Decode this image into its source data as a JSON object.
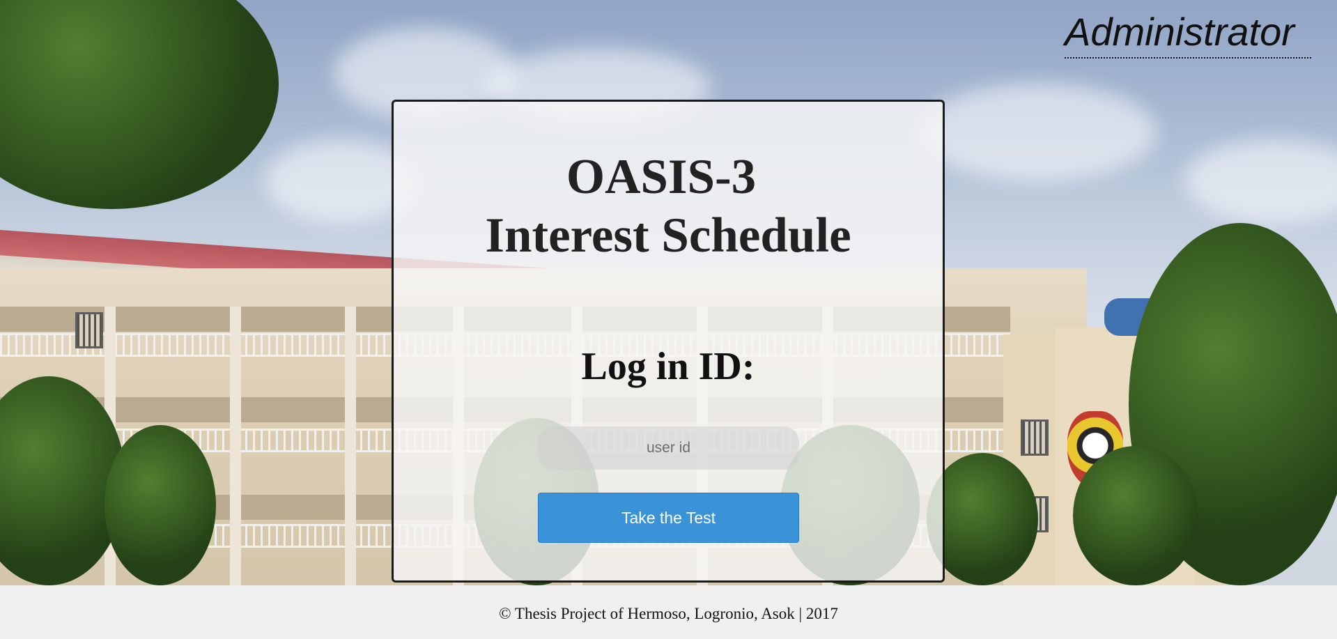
{
  "header": {
    "admin_link": "Administrator"
  },
  "login": {
    "title_line1": "OASIS-3",
    "title_line2": "Interest Schedule",
    "label": "Log in ID:",
    "userid_placeholder": "user id",
    "userid_value": "",
    "submit_label": "Take the Test"
  },
  "footer": {
    "text": "© Thesis Project of Hermoso, Logronio, Asok | 2017"
  },
  "colors": {
    "button": "#3a92d8",
    "card_border": "#1a1a1a",
    "footer_bg": "#f0f0f0"
  }
}
